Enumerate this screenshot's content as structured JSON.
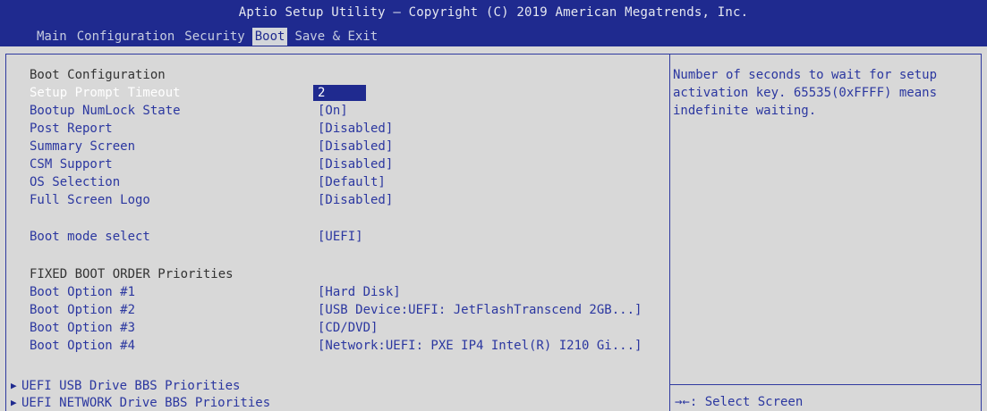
{
  "header": {
    "title": "Aptio Setup Utility – Copyright (C) 2019 American Megatrends, Inc.",
    "tabs": [
      "Main",
      "Configuration",
      "Security",
      "Boot",
      "Save & Exit"
    ],
    "active_tab": "Boot"
  },
  "main": {
    "section_boot_configuration": "Boot Configuration",
    "items": [
      {
        "label": "Setup Prompt Timeout",
        "value": "2"
      },
      {
        "label": "Bootup NumLock State",
        "value": "[On]"
      },
      {
        "label": "Post Report",
        "value": "[Disabled]"
      },
      {
        "label": "Summary Screen",
        "value": "[Disabled]"
      },
      {
        "label": "CSM Support",
        "value": "[Disabled]"
      },
      {
        "label": "OS Selection",
        "value": "[Default]"
      },
      {
        "label": "Full Screen Logo",
        "value": "[Disabled]"
      },
      {
        "label": "Boot mode select",
        "value": "[UEFI]"
      }
    ],
    "section_fixed_boot_order": "FIXED BOOT ORDER Priorities",
    "boot_options": [
      {
        "label": "Boot Option #1",
        "value": "[Hard Disk]"
      },
      {
        "label": "Boot Option #2",
        "value": "[USB Device:UEFI: JetFlashTranscend 2GB...]"
      },
      {
        "label": "Boot Option #3",
        "value": "[CD/DVD]"
      },
      {
        "label": "Boot Option #4",
        "value": "[Network:UEFI: PXE IP4 Intel(R) I210 Gi...]"
      }
    ],
    "submenus": [
      {
        "label": "UEFI USB Drive BBS Priorities"
      },
      {
        "label": "UEFI NETWORK Drive BBS Priorities"
      }
    ]
  },
  "help": {
    "text": "Number of seconds to wait for setup\nactivation key. 65535(0xFFFF) means\nindefinite waiting.",
    "key_hint": "→←: Select Screen"
  },
  "colors": {
    "header_bg": "#1f2a8f",
    "panel_bg": "#d8d8d8",
    "text_blue": "#2b37a0",
    "selected_text": "#ffffff"
  }
}
